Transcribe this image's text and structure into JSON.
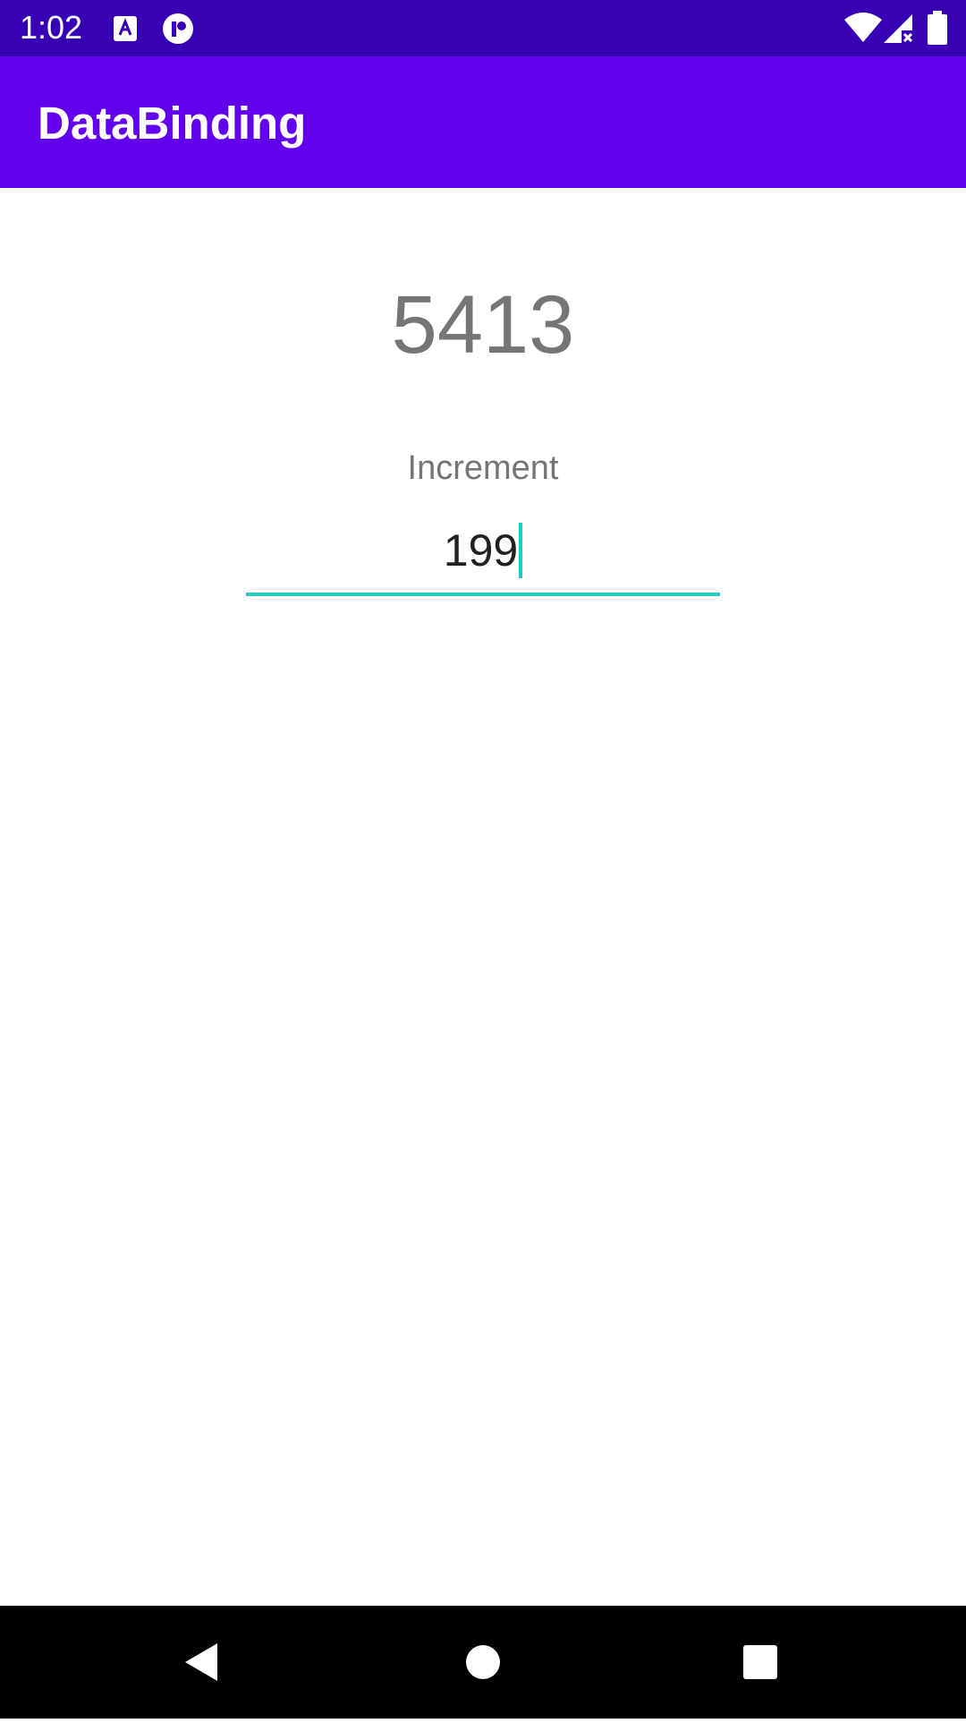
{
  "status_bar": {
    "time": "1:02",
    "background": "#3700b3",
    "icons": [
      "a-notification-icon",
      "app-notification-icon",
      "wifi-icon",
      "no-signal-icon",
      "battery-icon"
    ]
  },
  "app_bar": {
    "title": "DataBinding",
    "background": "#6200ee"
  },
  "main": {
    "counter_value": "5413",
    "increment_label": "Increment",
    "increment_input_value": "199",
    "accent_color": "#1fcbc4"
  },
  "nav_bar": {
    "icons": [
      "back-icon",
      "home-icon",
      "recents-icon"
    ]
  }
}
